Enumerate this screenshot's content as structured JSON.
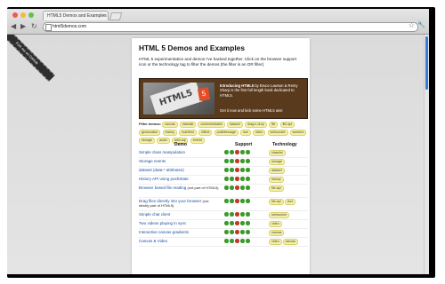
{
  "browser": {
    "tab_title": "HTML5 Demos and Examples",
    "tab_close": "×",
    "url": "html5demos.com",
    "nav": {
      "back": "◀",
      "forward": "▶",
      "reload": "↻"
    }
  },
  "ribbon": {
    "text": "Fork me on GitHub"
  },
  "page": {
    "title": "HTML 5 Demos and Examples",
    "intro": "HTML 5 experimentation and demos I've hacked together. Click on the browser support icon or the technology tag to filter the demos (the filter is an OR filter).",
    "promo": {
      "book_text": "HTML5",
      "heading": "Introducing HTML5",
      "body": " by Bruce Lawson & Remy Sharp is the first full length book dedicated to HTML5.",
      "cta": "Get it now and kick some HTML5 ass!"
    },
    "filter": {
      "label": "Filter demos:",
      "tags": [
        "canvas",
        "classlist",
        "contenteditable",
        "dataset",
        "drag-n-drop",
        "file",
        "file-api",
        "geolocation",
        "history",
        "manifest",
        "offline",
        "postMessage",
        "sse",
        "video",
        "websocket",
        "workers",
        "storage",
        "audio",
        "web-sql",
        "events"
      ]
    },
    "table": {
      "headers": {
        "demo": "Demo",
        "support": "Support",
        "technology": "Technology"
      },
      "rows": [
        {
          "name": "Simple class manipulation",
          "sub": "",
          "support": [
            "#3a9a2a",
            "#3a9a2a",
            "#c0392b",
            "#3a9a2a",
            "#3a9a2a"
          ],
          "tech": [
            "classlist"
          ]
        },
        {
          "name": "Storage events",
          "sub": "",
          "support": [
            "#3a9a2a",
            "#3a9a2a",
            "#c0392b",
            "#3a9a2a",
            "#3a9a2a"
          ],
          "tech": [
            "storage"
          ]
        },
        {
          "name": "dataset (data-* attributes)",
          "sub": "",
          "support": [
            "#3a9a2a",
            "#3a9a2a",
            "#c0392b",
            "#3a9a2a",
            "#3a9a2a"
          ],
          "tech": [
            "dataset"
          ]
        },
        {
          "name": "History API using pushState",
          "sub": "",
          "support": [
            "#3a9a2a",
            "#3a9a2a",
            "#c0392b",
            "#3a9a2a",
            "#3a9a2a"
          ],
          "tech": [
            "history"
          ]
        },
        {
          "name": "Browser based file reading",
          "sub": "(not part of HTML5)",
          "support": [
            "#3a9a2a",
            "#3a9a2a",
            "#c0392b",
            "#3a9a2a",
            "#3a9a2a"
          ],
          "tech": [
            "file-api"
          ]
        },
        {
          "name": "Drag files directly into your browser",
          "sub": "(not strictly part of HTML5)",
          "support": [
            "#3a9a2a",
            "#3a9a2a",
            "#c0392b",
            "#3a9a2a",
            "#3a9a2a"
          ],
          "tech": [
            "file-api",
            "dnd"
          ]
        },
        {
          "name": "Simple chat client",
          "sub": "",
          "support": [
            "#3a9a2a",
            "#3a9a2a",
            "#c0392b",
            "#3a9a2a",
            "#3a9a2a"
          ],
          "tech": [
            "websocket"
          ]
        },
        {
          "name": "Two videos playing in sync",
          "sub": "",
          "support": [
            "#3a9a2a",
            "#3a9a2a",
            "#c0392b",
            "#3a9a2a",
            "#3a9a2a"
          ],
          "tech": [
            "video"
          ]
        },
        {
          "name": "Interactive canvas gradients",
          "sub": "",
          "support": [
            "#3a9a2a",
            "#3a9a2a",
            "#c0392b",
            "#3a9a2a",
            "#3a9a2a"
          ],
          "tech": [
            "canvas"
          ]
        },
        {
          "name": "Canvas & Video",
          "sub": "",
          "support": [
            "#3a9a2a",
            "#3a9a2a",
            "#c0392b",
            "#3a9a2a",
            "#3a9a2a"
          ],
          "tech": [
            "video",
            "canvas"
          ]
        }
      ]
    }
  }
}
